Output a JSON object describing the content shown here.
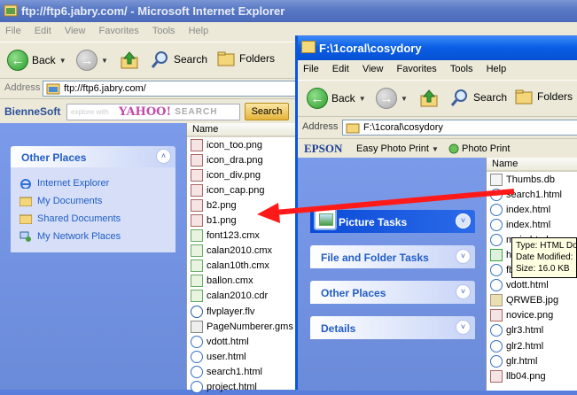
{
  "ftp_window": {
    "title": "ftp://ftp6.jabry.com/ - Microsoft Internet Explorer",
    "menu": [
      "File",
      "Edit",
      "View",
      "Favorites",
      "Tools",
      "Help"
    ],
    "toolbar": {
      "back": "Back",
      "search": "Search",
      "folders": "Folders"
    },
    "address_label": "Address",
    "address": "ftp://ftp6.jabry.com/",
    "search_bar": {
      "brand": "BienneSoft",
      "placeholder": "explore with",
      "engine": "YAHOO!",
      "engine_suffix": "SEARCH",
      "button": "Search"
    },
    "other_places": {
      "title": "Other Places",
      "items": [
        {
          "label": "Internet Explorer",
          "icon": "internet-explorer-icon"
        },
        {
          "label": "My Documents",
          "icon": "folder-icon"
        },
        {
          "label": "Shared Documents",
          "icon": "folder-icon"
        },
        {
          "label": "My Network Places",
          "icon": "network-icon"
        }
      ]
    },
    "column_header": "Name",
    "files": [
      {
        "name": "icon_too.png",
        "type": "png"
      },
      {
        "name": "icon_dra.png",
        "type": "png"
      },
      {
        "name": "icon_div.png",
        "type": "png"
      },
      {
        "name": "icon_cap.png",
        "type": "png"
      },
      {
        "name": "b2.png",
        "type": "png"
      },
      {
        "name": "b1.png",
        "type": "png"
      },
      {
        "name": "font123.cmx",
        "type": "cmx"
      },
      {
        "name": "calan2010.cmx",
        "type": "cmx"
      },
      {
        "name": "calan10th.cmx",
        "type": "cmx"
      },
      {
        "name": "ballon.cmx",
        "type": "cmx"
      },
      {
        "name": "calan2010.cdr",
        "type": "cdr"
      },
      {
        "name": "flvplayer.flv",
        "type": "flv"
      },
      {
        "name": "PageNumberer.gms",
        "type": "gms"
      },
      {
        "name": "vdott.html",
        "type": "html"
      },
      {
        "name": "user.html",
        "type": "html"
      },
      {
        "name": "search1.html",
        "type": "html"
      },
      {
        "name": "project.html",
        "type": "html"
      }
    ]
  },
  "local_window": {
    "title": "F:\\1coral\\cosydory",
    "menu": [
      "File",
      "Edit",
      "View",
      "Favorites",
      "Tools",
      "Help"
    ],
    "toolbar": {
      "back": "Back",
      "search": "Search",
      "folders": "Folders"
    },
    "address_label": "Address",
    "address": "F:\\1coral\\cosydory",
    "epson_bar": {
      "brand": "EPSON",
      "easy_print": "Easy Photo Print",
      "photo_print": "Photo Print"
    },
    "tasks": [
      {
        "label": "Picture Tasks",
        "active": true
      },
      {
        "label": "File and Folder Tasks",
        "active": false
      },
      {
        "label": "Other Places",
        "active": false
      },
      {
        "label": "Details",
        "active": false
      }
    ],
    "column_header": "Name",
    "files": [
      {
        "name": "Thumbs.db",
        "type": "db"
      },
      {
        "name": "search1.html",
        "type": "html"
      },
      {
        "name": "index.html",
        "type": "html"
      },
      {
        "name": "index.html",
        "type": "html"
      },
      {
        "name": "main.html",
        "type": "html"
      },
      {
        "name": "hcgst.htm",
        "type": "xls"
      },
      {
        "name": "fb.html",
        "type": "html"
      },
      {
        "name": "vdott.html",
        "type": "html"
      },
      {
        "name": "QRWEB.jpg",
        "type": "jpg"
      },
      {
        "name": "novice.png",
        "type": "png"
      },
      {
        "name": "glr3.html",
        "type": "html"
      },
      {
        "name": "glr2.html",
        "type": "html"
      },
      {
        "name": "glr.html",
        "type": "html"
      },
      {
        "name": "llb04.png",
        "type": "png"
      }
    ],
    "tooltip": {
      "line1": "Type: HTML Do",
      "line2": "Date Modified:",
      "line3": "Size: 16.0 KB"
    }
  },
  "colors": {
    "arrow": "#ff1a1a",
    "xp_blue": "#0a5fe4",
    "task_link": "#215dc6"
  }
}
